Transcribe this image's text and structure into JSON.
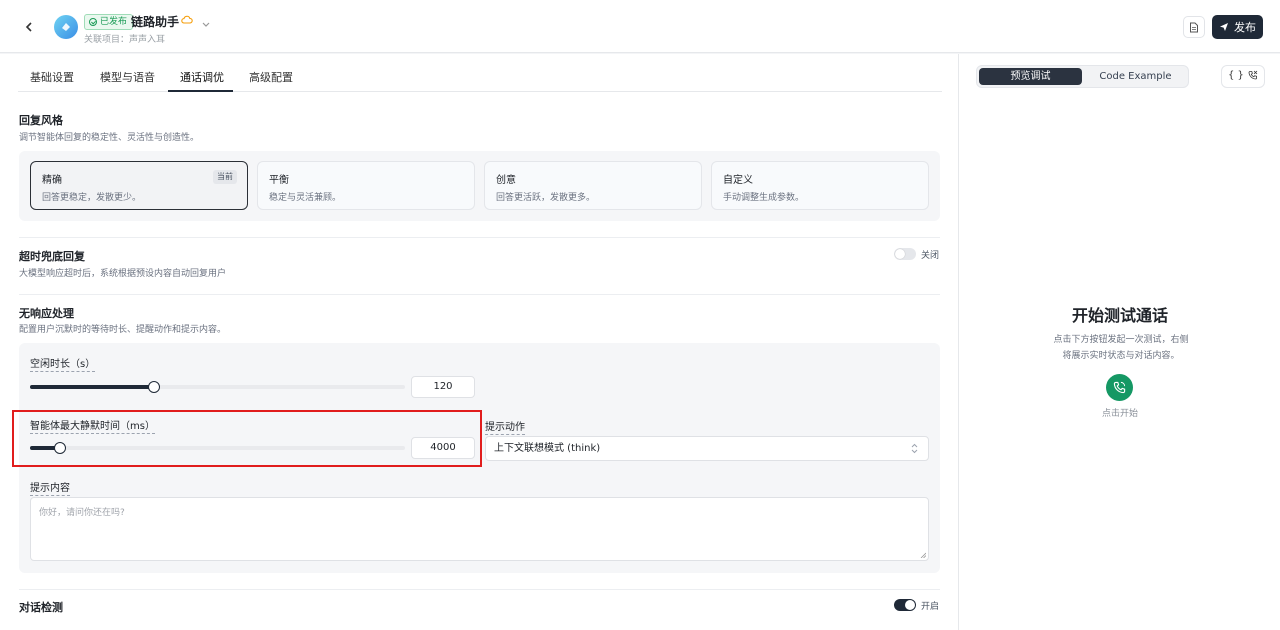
{
  "header": {
    "badge": "已发布",
    "app_name": "链路助手",
    "project_line": "关联项目：声声入耳",
    "publish_label": "发布"
  },
  "tabs": [
    "基础设置",
    "模型与语音",
    "通话调优",
    "高级配置"
  ],
  "active_tab": "通话调优",
  "reply_style": {
    "title": "回复风格",
    "desc": "调节智能体回复的稳定性、灵活性与创造性。",
    "current_tag": "当前",
    "options": [
      {
        "name": "精确",
        "desc": "回答更稳定，发散更少。",
        "active": true
      },
      {
        "name": "平衡",
        "desc": "稳定与灵活兼顾。",
        "active": false
      },
      {
        "name": "创意",
        "desc": "回答更活跃，发散更多。",
        "active": false
      },
      {
        "name": "自定义",
        "desc": "手动调整生成参数。",
        "active": false
      }
    ]
  },
  "timeout": {
    "title": "超时兜底回复",
    "desc": "大模型响应超时后，系统根据预设内容自动回复用户",
    "enabled": false,
    "state_label": "关闭"
  },
  "no_response": {
    "title": "无响应处理",
    "desc": "配置用户沉默时的等待时长、提醒动作和提示内容。",
    "idle_label": "空闲时长（s）",
    "idle_value": "120",
    "idle_fraction": 0.33,
    "silence_label": "智能体最大静默时间（ms）",
    "silence_value": "4000",
    "silence_fraction": 0.08,
    "action_label": "提示动作",
    "action_value": "上下文联想模式 (think)",
    "content_label": "提示内容",
    "content_placeholder": "你好，请问你还在吗?"
  },
  "dialog_detect": {
    "title": "对话检测",
    "enabled": true,
    "state_label": "开启"
  },
  "preview": {
    "tab_preview": "预览调试",
    "tab_code": "Code Example",
    "code_icon": "{ }",
    "start_title": "开始测试通话",
    "start_desc": "点击下方按钮发起一次测试，右侧将展示实时状态与对话内容。",
    "start_label": "点击开始"
  },
  "colors": {
    "accent": "#1f2937",
    "call_green": "#159864",
    "highlight_red": "#e11d1d"
  }
}
